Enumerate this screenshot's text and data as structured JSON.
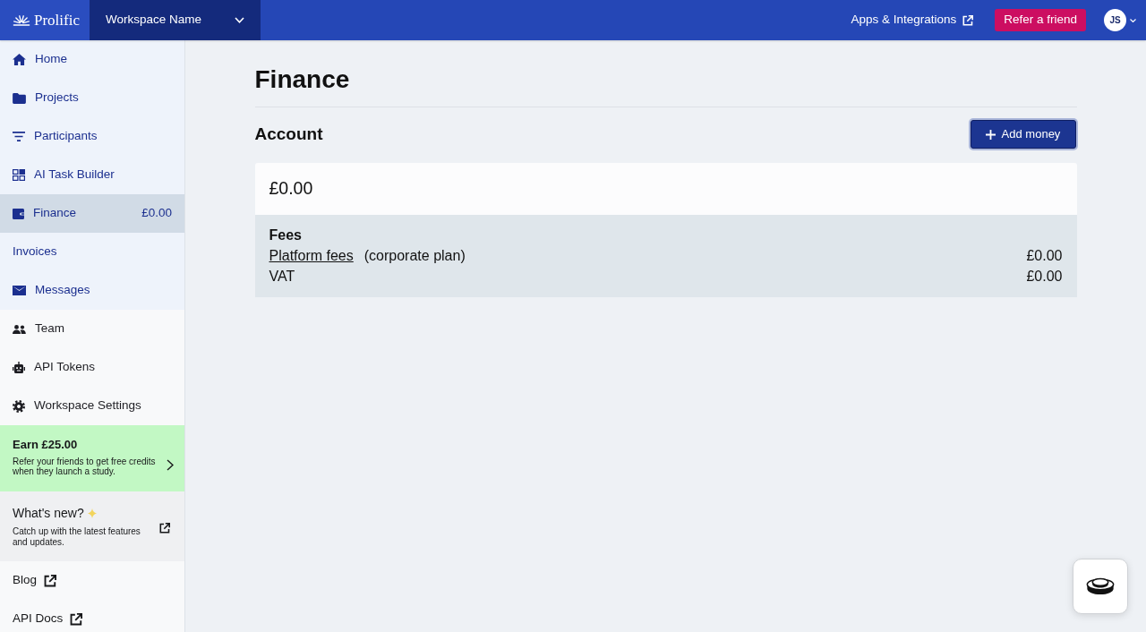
{
  "topbar": {
    "logo": "Prolific",
    "workspace": "Workspace Name",
    "links": [
      {
        "label": "Apps & Integrations",
        "external": true
      }
    ],
    "refer_button": "Refer a friend",
    "avatar": "JS"
  },
  "sidebar": {
    "workspace_items": [
      {
        "label": "Home",
        "selected": false
      },
      {
        "label": "Projects",
        "selected": false
      },
      {
        "label": "Participants",
        "selected": false
      },
      {
        "label": "AI Task Builder",
        "selected": false
      },
      {
        "label": "Finance",
        "value": "£0.00",
        "selected": true,
        "children": [
          {
            "label": "Invoices",
            "selected": false
          }
        ]
      },
      {
        "label": "Messages",
        "selected": false
      }
    ],
    "account_items": [
      {
        "label": "Team",
        "selected": false
      },
      {
        "label": "API Tokens",
        "selected": false
      },
      {
        "label": "Workspace Settings",
        "selected": false
      }
    ],
    "promo": {
      "title": "Earn £25.00",
      "text": "Refer your friends to get free credits when they launch a study."
    },
    "whats_new": {
      "title": "What's new?",
      "text": "Catch up with the latest features and updates.",
      "external": true
    },
    "links": [
      {
        "label": "Blog",
        "external": true
      },
      {
        "label": "API Docs",
        "external": true
      }
    ]
  },
  "page": {
    "title": "Finance",
    "section": "Account",
    "add_button": "Add money",
    "balance": "£0.00",
    "fees": {
      "title": "Fees",
      "rows": [
        {
          "label": "Platform fees",
          "link": true,
          "note": "(corporate plan)",
          "amount": "£0.00"
        },
        {
          "label": "VAT",
          "link": false,
          "amount": "£0.00"
        }
      ]
    }
  }
}
